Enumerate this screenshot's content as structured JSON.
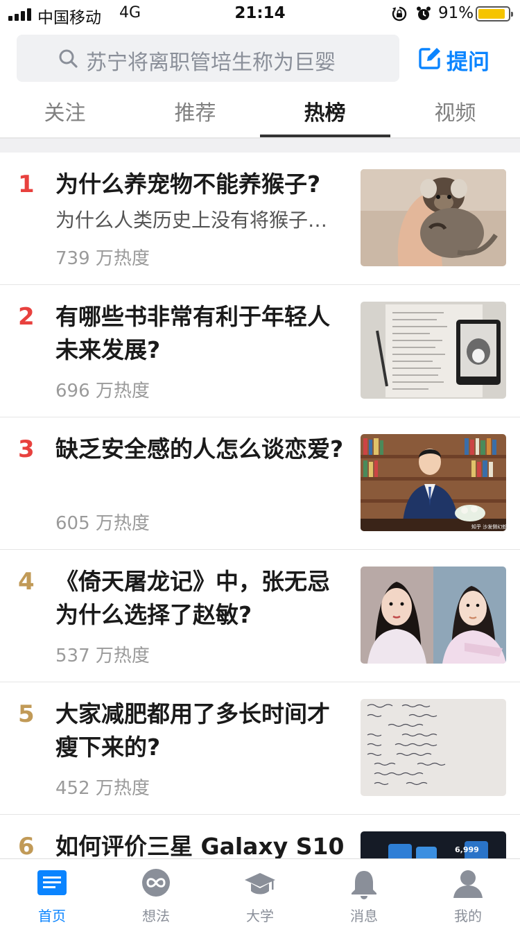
{
  "status_bar": {
    "carrier": "中国移动",
    "network": "4G",
    "time": "21:14",
    "battery_percent": "91%",
    "battery_level": 0.91,
    "icons": [
      "signal-icon",
      "orientation-lock-icon",
      "alarm-icon",
      "battery-icon"
    ]
  },
  "search": {
    "placeholder": "苏宁将离职管培生称为巨婴",
    "icon": "search-icon"
  },
  "ask_button": {
    "label": "提问",
    "icon": "edit-icon"
  },
  "tabs": [
    {
      "label": "关注",
      "active": false
    },
    {
      "label": "推荐",
      "active": false
    },
    {
      "label": "热榜",
      "active": true
    },
    {
      "label": "视频",
      "active": false
    }
  ],
  "hot_list": [
    {
      "rank": "1",
      "title": "为什么养宠物不能养猴子?",
      "excerpt": "为什么人类历史上没有将猴子…",
      "heat": "739 万热度",
      "thumb": "monkey-photo"
    },
    {
      "rank": "2",
      "title": "有哪些书非常有利于年轻人未来发展?",
      "excerpt": "",
      "heat": "696 万热度",
      "thumb": "notes-and-ereader-photo"
    },
    {
      "rank": "3",
      "title": "缺乏安全感的人怎么谈恋爱?",
      "excerpt": "",
      "heat": "605 万热度",
      "thumb": "man-in-library-photo",
      "thumb_watermark": "知乎 沙发侧幻蛇"
    },
    {
      "rank": "4",
      "title": "《倚天屠龙记》中，张无忌为什么选择了赵敏?",
      "excerpt": "",
      "heat": "537 万热度",
      "thumb": "tv-drama-actresses-photo"
    },
    {
      "rank": "5",
      "title": "大家减肥都用了多长时间才瘦下来的?",
      "excerpt": "",
      "heat": "452 万热度",
      "thumb": "handwritten-diet-notes-photo"
    },
    {
      "rank": "6",
      "title": "如何评价三星 Galaxy S10",
      "excerpt": "",
      "heat": "",
      "thumb": "phone-launch-photo",
      "thumb_price": "6,999"
    }
  ],
  "colors": {
    "accent": "#0a84ff",
    "rank_top": "#e8413e",
    "rank_other": "#c19a57"
  },
  "bottom_nav": [
    {
      "label": "首页",
      "icon": "home-list-icon",
      "active": true
    },
    {
      "label": "想法",
      "icon": "infinity-icon",
      "active": false
    },
    {
      "label": "大学",
      "icon": "graduation-cap-icon",
      "active": false
    },
    {
      "label": "消息",
      "icon": "bell-icon",
      "active": false
    },
    {
      "label": "我的",
      "icon": "user-icon",
      "active": false
    }
  ]
}
